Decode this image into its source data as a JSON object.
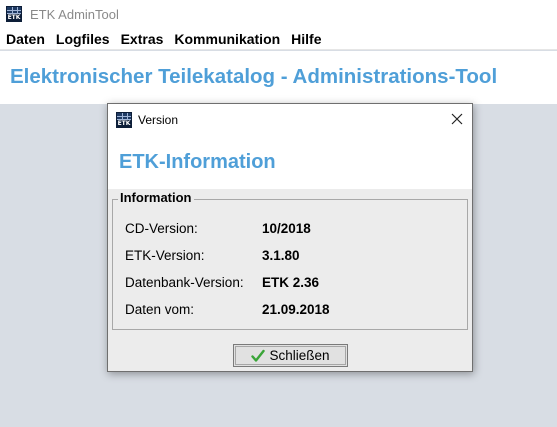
{
  "window": {
    "title": "ETK AdminTool",
    "icon": "etk-app-icon",
    "icon_text": "ETK"
  },
  "menubar": {
    "items": [
      "Daten",
      "Logfiles",
      "Extras",
      "Kommunikation",
      "Hilfe"
    ]
  },
  "main": {
    "heading": "Elektronischer Teilekatalog - Administrations-Tool"
  },
  "dialog": {
    "title": "Version",
    "icon_text": "ETK",
    "close_icon": "close-icon",
    "heading": "ETK-Information",
    "group_title": "Information",
    "rows": [
      {
        "label": "CD-Version:",
        "value": "10/2018"
      },
      {
        "label": "ETK-Version:",
        "value": "3.1.80"
      },
      {
        "label": "Datenbank-Version:",
        "value": "ETK 2.36"
      },
      {
        "label": "Daten vom:",
        "value": "21.09.2018"
      }
    ],
    "close_button": {
      "label": "Schließen",
      "icon": "check-icon"
    }
  },
  "colors": {
    "heading_blue": "#4f9fd8",
    "background": "#d8dde4",
    "dialog_background": "#ececec",
    "check_green": "#3aa538"
  }
}
